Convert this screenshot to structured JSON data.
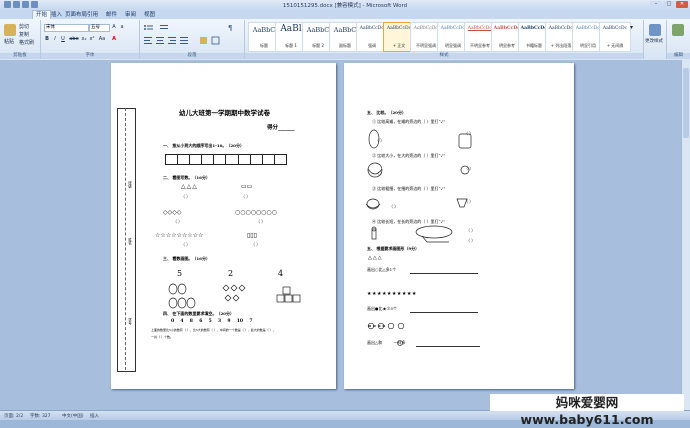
{
  "window": {
    "title": "1510151295.docx [兼容模式] - Microsoft Word",
    "controls": {
      "minimize": "–",
      "maximize": "□",
      "close": "✕"
    }
  },
  "tabs": [
    "开始",
    "插入",
    "页面布局",
    "引用",
    "邮件",
    "审阅",
    "视图"
  ],
  "ribbon": {
    "clipboard": {
      "paste": "粘贴",
      "cut": "剪切",
      "copy": "复制",
      "format_painter": "格式刷",
      "label": "剪贴板"
    },
    "font": {
      "name": "宋体",
      "size": "五号",
      "bold": "B",
      "italic": "I",
      "underline": "U",
      "strike": "abe",
      "sub": "x₂",
      "sup": "x²",
      "case": "Aa",
      "color": "A",
      "label": "字体"
    },
    "paragraph": {
      "label": "段落"
    },
    "styles": {
      "items": [
        {
          "sample": "AaBbC",
          "name": "标题"
        },
        {
          "sample": "AaBl",
          "name": "标题 1"
        },
        {
          "sample": "AaBbC",
          "name": "标题 2"
        },
        {
          "sample": "AaBbC",
          "name": "副标题"
        },
        {
          "sample": "AaBbCcDd",
          "name": "强调"
        },
        {
          "sample": "AaBbCcDc",
          "name": "+ 正文"
        },
        {
          "sample": "AaBbCcDd",
          "name": "不明显强调"
        },
        {
          "sample": "AaBbCcDd",
          "name": "明显强调"
        },
        {
          "sample": "AaBbCcDd",
          "name": "不明显参考"
        },
        {
          "sample": "AaBbCcDd",
          "name": "明显参考"
        },
        {
          "sample": "AaBbCcDd",
          "name": "书籍标题"
        },
        {
          "sample": "AaBbCcDd",
          "name": "+ 列出段落"
        },
        {
          "sample": "AaBbCcDd",
          "name": "明显引用"
        },
        {
          "sample": "AaBbCcDc",
          "name": "+ 无间隔"
        }
      ],
      "change_styles": "更改样式",
      "label": "样式"
    },
    "editing": {
      "label": "编辑"
    }
  },
  "page1": {
    "title": "幼儿大班第一学期期中数学试卷",
    "score": "得分______",
    "q1": "一、 按从小到大的顺序写出1-10。（20分）",
    "q2": "二、 看图写数。（16分）",
    "q3": "三、 看数画图。（16分）",
    "q3_numbers": [
      "5",
      "2",
      "4"
    ],
    "q4": "四、 在下面的数里要求填空。（20分）",
    "q4_numbers": "0    4    8    6    5    3    9    10    7",
    "q4_line1": "上面的数里比5小的数有（    ），比5大的数有（    ），中间的一个数是（    ），最大的数是（    ），",
    "q4_line2": "一共（    ）个数。",
    "grid_count": 10,
    "blank": "（    ）",
    "binding_labels": [
      "班级",
      "姓名",
      "学号"
    ]
  },
  "page2": {
    "q5": "五、 比较。（20分）",
    "q5_items": [
      "①  比较高矮，在矮的旁边的（    ）里打“✓”",
      "②  比较大小，在大的旁边的（    ）里打“✓”",
      "③  比较粗细，在细的旁边的（    ）里打“✓”",
      "④  比较长短，在长的旁边的（    ）里打“✓”"
    ],
    "q6": "五、 根据要求画图形（9分）",
    "q6_tri_row": "△△△",
    "q6_line1": "画出○比△多1个",
    "q6_star_row": "★★★★★★★★★★",
    "q6_line2": "画出●比★少5个",
    "q6_line3": "画出△和         一样多",
    "blank": "（    ）"
  },
  "statusbar": {
    "page": "页面: 2/2",
    "words": "字数: 327",
    "lang": "中文(中国)",
    "insert": "插入",
    "zoom_value": "60%"
  },
  "watermark": "妈咪爱婴网 www.baby611.com"
}
